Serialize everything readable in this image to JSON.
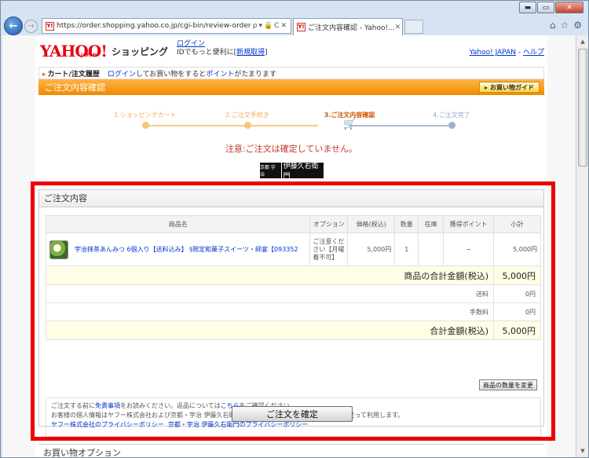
{
  "browser": {
    "address_url": "https://order.shopping.yahoo.co.jp/cgi-bin/review-order?cata",
    "address_icons": "ρ▾🔒C✕",
    "tab_title": "ご注文内容確認 - Yahoo!...",
    "tab_close": "✕",
    "window_controls": {
      "minimize": "▬",
      "maximize": "▭",
      "close": "✕"
    },
    "tools": {
      "home": "⌂",
      "favorites": "☆",
      "settings": "⚙"
    },
    "back": "←",
    "forward": "→",
    "favicon": "Y!"
  },
  "header": {
    "logo_main": "YAHOO!",
    "logo_japan": "JAPAN",
    "logo_shopping": "ショッピング",
    "login_link": "ログイン",
    "login_line2_prefix": "IDでもっと便利に[",
    "signup_link": "新規取得",
    "login_line2_suffix": "]",
    "yahoo_japan_link": "Yahoo! JAPAN",
    "sep": " - ",
    "help_link": "ヘルプ"
  },
  "cart_bar": {
    "label": "カート/注文履歴",
    "login_link": "ログイン",
    "text_mid": "してお買い物をすると",
    "points_link": "ポイント",
    "text_end": "がたまります"
  },
  "title_bar": {
    "title": "ご注文内容確認",
    "guide_button": "お買い物ガイド"
  },
  "steps": [
    {
      "label": "1.ショッピングカート",
      "state": "done"
    },
    {
      "label": "2.ご注文手続き",
      "state": "done"
    },
    {
      "label": "3.ご注文内容確認",
      "state": "active"
    },
    {
      "label": "4.ご注文完了",
      "state": "todo"
    }
  ],
  "notice": "注意:ご注文は確定していません。",
  "shop_logo": {
    "small": "京都 宇治",
    "big": "伊藤久右衛門"
  },
  "order": {
    "heading": "ご注文内容",
    "columns": [
      "商品名",
      "オプション",
      "価格(税込)",
      "数量",
      "在庫",
      "獲得ポイント",
      "小計"
    ],
    "item": {
      "name": "宇治抹茶あんみつ 6個入り【送料込み】 §限定和菓子スイーツ・師宴【093352",
      "option": "ご注意ください【月曜着不可】",
      "price": "5,000円",
      "qty": "1",
      "stock": "",
      "points": "−",
      "subtotal": "5,000円"
    },
    "goods_total_label": "商品の合計金額(税込)",
    "goods_total_value": "5,000円",
    "shipping_label": "送料",
    "shipping_value": "0円",
    "fee_label": "手数料",
    "fee_value": "0円",
    "grand_total_label": "合計金額(税込)",
    "grand_total_value": "5,000円",
    "change_qty_button": "商品の数量を変更"
  },
  "notes": {
    "line1_prefix": "ご注文する前に",
    "disclaimer_link": "免責事項",
    "line1_mid": "をお読みください。返品については",
    "here_link": "こちら",
    "line1_suffix": "をご確認ください。",
    "line2": "お客様の個人情報はヤフー株式会社および京都・宇治 伊藤久右衛門が取得し、各プライバシーポリシーに従って利用します。",
    "yahoo_policy_link": "ヤフー株式会社のプライバシーポリシー",
    "shop_policy_link": "京都・宇治 伊藤久右衛門のプライバシーポリシー"
  },
  "confirm_button": "ご注文を確定",
  "bottom_section": "お買い物オプション"
}
